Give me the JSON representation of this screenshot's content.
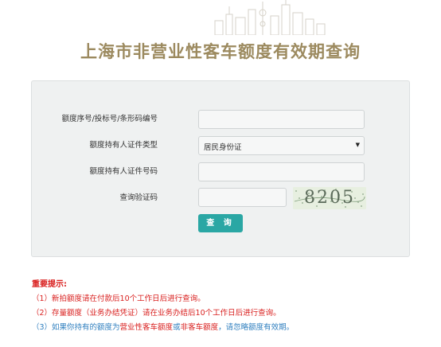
{
  "page": {
    "title": "上海市非营业性客车额度有效期查询"
  },
  "form": {
    "fields": [
      {
        "label": "额度序号/投标号/条形码编号",
        "value": ""
      },
      {
        "label": "额度持有人证件类型",
        "value": "居民身份证"
      },
      {
        "label": "额度持有人证件号码",
        "value": ""
      },
      {
        "label": "查询验证码",
        "value": ""
      }
    ],
    "captcha_text": "8205",
    "submit_label": "查 询"
  },
  "notes": {
    "title": "重要提示:",
    "items": [
      "（1）新拍额度请在付款后10个工作日后进行查询。",
      "（2）存量额度（业务办结凭证）请在业务办结后10个工作日后进行查询。"
    ],
    "item3_parts": [
      "（3）如果你持有的额度为",
      "营业性客车额度",
      "或",
      "非客车额度",
      "，请忽略额度有效期。"
    ]
  },
  "colors": {
    "title": "#9c8a5f",
    "accent": "#2aa7a4",
    "warning": "#d9201f",
    "info": "#2f7fbf"
  }
}
